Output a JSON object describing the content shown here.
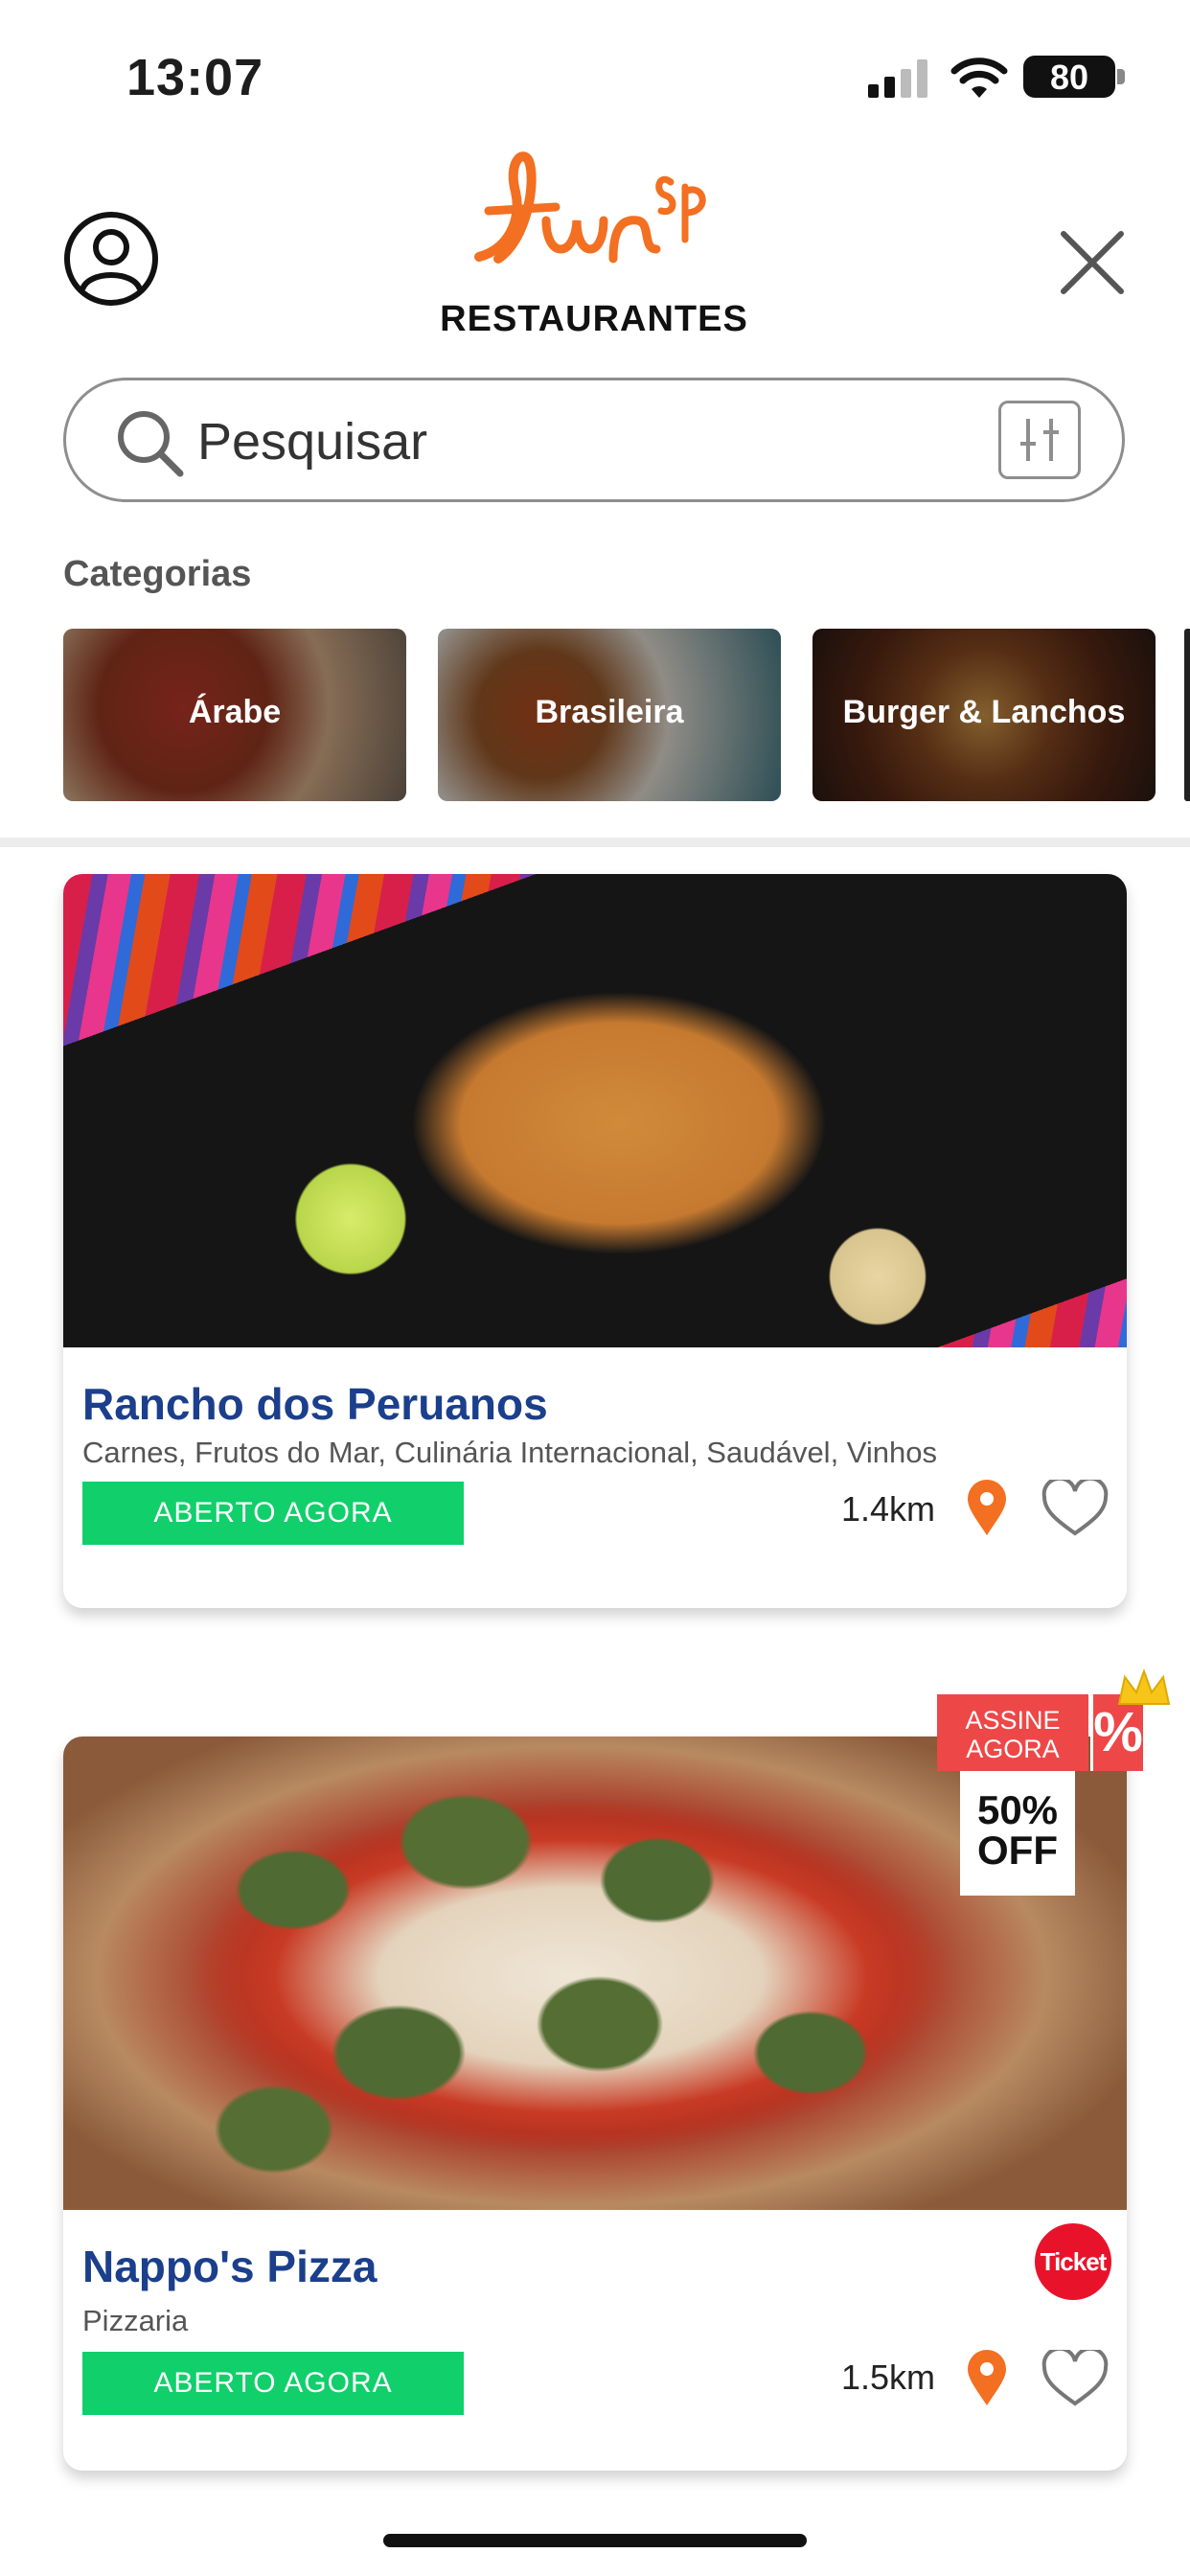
{
  "status_bar": {
    "time": "13:07",
    "battery": "80"
  },
  "header": {
    "logo_text": "fun sp",
    "section": "RESTAURANTES"
  },
  "search": {
    "placeholder": "Pesquisar"
  },
  "categories": {
    "title": "Categorias",
    "items": [
      {
        "label": "Árabe"
      },
      {
        "label": "Brasileira"
      },
      {
        "label": "Burger & Lanchos"
      }
    ]
  },
  "restaurants": [
    {
      "name": "Rancho dos Peruanos",
      "cuisine": "Carnes, Frutos do Mar, Culinária Internacional, Saudável, Vinhos",
      "status": "ABERTO AGORA",
      "distance": "1.4km"
    },
    {
      "name": "Nappo's Pizza",
      "cuisine": "Pizzaria",
      "status": "ABERTO AGORA",
      "distance": "1.5km",
      "badge": "Ticket"
    }
  ],
  "promo": {
    "top": "ASSINE AGORA",
    "symbol": "%",
    "discount": "50% OFF"
  },
  "colors": {
    "brand_orange": "#f36f21",
    "open_green": "#11cf6b",
    "title_blue": "#1b3f8c",
    "promo_red": "#ee4748"
  }
}
